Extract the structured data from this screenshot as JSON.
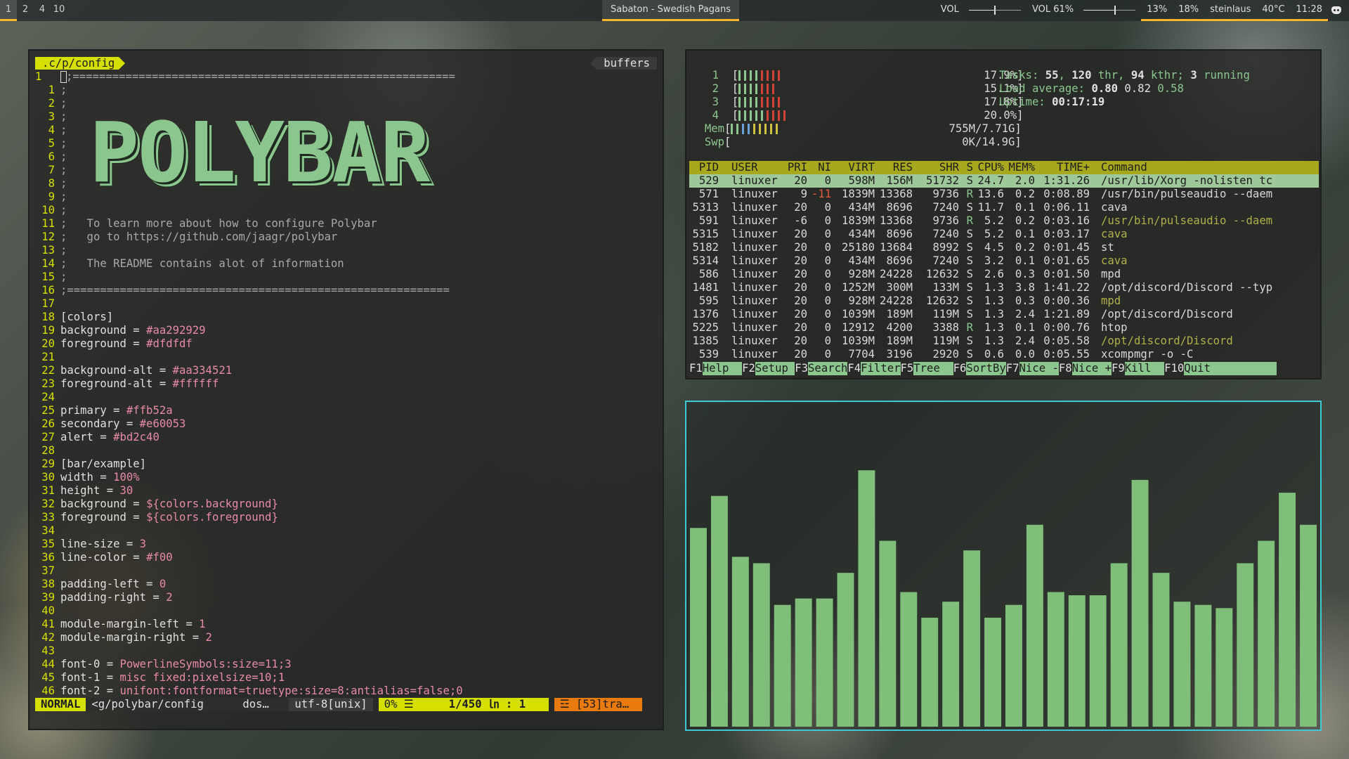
{
  "bar": {
    "workspaces": [
      "1",
      "2",
      "4",
      "10"
    ],
    "active_workspace": "1",
    "window_title": "Sabaton - Swedish Pagans",
    "vol1_label": "VOL",
    "vol1_level": 0.5,
    "vol2_label": "VOL 61%",
    "vol2_level": 0.61,
    "cpu": "13%",
    "mem": "18%",
    "host": "steinlaus",
    "temp": "40°C",
    "clock": "11:28",
    "tray_icon": "discord-icon",
    "accent": "#ffb52a"
  },
  "vim": {
    "path": ".c/p/config",
    "buffers": "buffers",
    "ascii_art": "POLYBAR",
    "lines": [
      {
        "n": "1",
        "t": ";==========================================================",
        "c": true
      },
      {
        "n": "1",
        "t": ";"
      },
      {
        "n": "2",
        "t": ";"
      },
      {
        "n": "3",
        "t": ";"
      },
      {
        "n": "4",
        "t": ";"
      },
      {
        "n": "5",
        "t": ";"
      },
      {
        "n": "6",
        "t": ";"
      },
      {
        "n": "7",
        "t": ";"
      },
      {
        "n": "8",
        "t": ";"
      },
      {
        "n": "9",
        "t": ";"
      },
      {
        "n": "10",
        "t": ";"
      },
      {
        "n": "11",
        "t": ";   To learn more about how to configure Polybar"
      },
      {
        "n": "12",
        "t": ";   go to https://github.com/jaagr/polybar"
      },
      {
        "n": "13",
        "t": ";"
      },
      {
        "n": "14",
        "t": ";   The README contains alot of information"
      },
      {
        "n": "15",
        "t": ";"
      },
      {
        "n": "16",
        "t": ";=========================================================="
      },
      {
        "n": "17",
        "t": ""
      },
      {
        "n": "18",
        "s": "[colors]"
      },
      {
        "n": "19",
        "k": "background = ",
        "v": "#aa292929"
      },
      {
        "n": "20",
        "k": "foreground = ",
        "v": "#dfdfdf"
      },
      {
        "n": "21",
        "t": ""
      },
      {
        "n": "22",
        "k": "background-alt = ",
        "v": "#aa334521"
      },
      {
        "n": "23",
        "k": "foreground-alt = ",
        "v": "#ffffff"
      },
      {
        "n": "24",
        "t": ""
      },
      {
        "n": "25",
        "k": "primary = ",
        "v": "#ffb52a"
      },
      {
        "n": "26",
        "k": "secondary = ",
        "v": "#e60053"
      },
      {
        "n": "27",
        "k": "alert = ",
        "v": "#bd2c40"
      },
      {
        "n": "28",
        "t": ""
      },
      {
        "n": "29",
        "s": "[bar/example]"
      },
      {
        "n": "30",
        "k": "width = ",
        "v": "100%"
      },
      {
        "n": "31",
        "k": "height = ",
        "v": "30"
      },
      {
        "n": "32",
        "k": "background = ",
        "v": "${colors.background}"
      },
      {
        "n": "33",
        "k": "foreground = ",
        "v": "${colors.foreground}"
      },
      {
        "n": "34",
        "t": ""
      },
      {
        "n": "35",
        "k": "line-size = ",
        "v": "3"
      },
      {
        "n": "36",
        "k": "line-color = ",
        "v": "#f00"
      },
      {
        "n": "37",
        "t": ""
      },
      {
        "n": "38",
        "k": "padding-left = ",
        "v": "0"
      },
      {
        "n": "39",
        "k": "padding-right = ",
        "v": "2"
      },
      {
        "n": "40",
        "t": ""
      },
      {
        "n": "41",
        "k": "module-margin-left = ",
        "v": "1"
      },
      {
        "n": "42",
        "k": "module-margin-right = ",
        "v": "2"
      },
      {
        "n": "43",
        "t": ""
      },
      {
        "n": "44",
        "k": "font-0 = ",
        "v": "PowerlineSymbols:size=11;3"
      },
      {
        "n": "45",
        "k": "font-1 = ",
        "v": "misc fixed:pixelsize=10;1"
      },
      {
        "n": "46",
        "k": "font-2 = ",
        "v": "unifont:fontformat=truetype:size=8:antialias=false;0"
      }
    ],
    "status": {
      "mode": "NORMAL",
      "file": "<g/polybar/config",
      "ff": "dos…",
      "enc": "utf-8[unix]",
      "pct": " 0% ☰",
      "pos": "1/450 ㏑ :  1",
      "warn": "☲ [53]tra…"
    }
  },
  "htop": {
    "cpus": [
      {
        "id": "1",
        "value": "17.9%",
        "green": 4,
        "red": 4
      },
      {
        "id": "2",
        "value": "15.1%",
        "green": 4,
        "red": 3
      },
      {
        "id": "3",
        "value": "17.8%",
        "green": 4,
        "red": 4
      },
      {
        "id": "4",
        "value": "20.0%",
        "green": 5,
        "red": 4
      }
    ],
    "mem": {
      "label": "Mem",
      "value": "755M/7.71G"
    },
    "swp": {
      "label": "Swp",
      "value": "0K/14.9G"
    },
    "tasks_label": "Tasks:",
    "tasks": "55",
    "thr": "120",
    "thr_label": "thr,",
    "kthr": "94",
    "kthr_label": "kthr;",
    "running": "3",
    "running_label": "running",
    "load_label": "Load average:",
    "load1": "0.80",
    "load5": "0.82",
    "load15": "0.58",
    "uptime_label": "Uptime:",
    "uptime": "00:17:19",
    "headers": [
      "PID",
      "USER",
      "PRI",
      "NI",
      "VIRT",
      "RES",
      "SHR",
      "S",
      "CPU%",
      "MEM%",
      "TIME+",
      "Command"
    ],
    "processes": [
      [
        "529",
        "linuxer",
        "20",
        "0",
        "598M",
        "156M",
        "51732",
        "S",
        "24.7",
        "2.0",
        "1:31.26",
        "/usr/lib/Xorg -nolisten tc"
      ],
      [
        "571",
        "linuxer",
        "9",
        "-11",
        "1839M",
        "13368",
        "9736",
        "R",
        "13.6",
        "0.2",
        "0:08.89",
        "/usr/bin/pulseaudio --daem"
      ],
      [
        "5313",
        "linuxer",
        "20",
        "0",
        "434M",
        "8696",
        "7240",
        "S",
        "11.7",
        "0.1",
        "0:06.11",
        "cava"
      ],
      [
        "591",
        "linuxer",
        "-6",
        "0",
        "1839M",
        "13368",
        "9736",
        "R",
        "5.2",
        "0.2",
        "0:03.16",
        "/usr/bin/pulseaudio --daem"
      ],
      [
        "5315",
        "linuxer",
        "20",
        "0",
        "434M",
        "8696",
        "7240",
        "S",
        "5.2",
        "0.1",
        "0:03.17",
        "cava"
      ],
      [
        "5182",
        "linuxer",
        "20",
        "0",
        "25180",
        "13684",
        "8992",
        "S",
        "4.5",
        "0.2",
        "0:01.45",
        "st"
      ],
      [
        "5314",
        "linuxer",
        "20",
        "0",
        "434M",
        "8696",
        "7240",
        "S",
        "3.2",
        "0.1",
        "0:01.65",
        "cava"
      ],
      [
        "586",
        "linuxer",
        "20",
        "0",
        "928M",
        "24228",
        "12632",
        "S",
        "2.6",
        "0.3",
        "0:01.50",
        "mpd"
      ],
      [
        "1481",
        "linuxer",
        "20",
        "0",
        "1252M",
        "300M",
        "133M",
        "S",
        "1.3",
        "3.8",
        "1:41.22",
        "/opt/discord/Discord --typ"
      ],
      [
        "595",
        "linuxer",
        "20",
        "0",
        "928M",
        "24228",
        "12632",
        "S",
        "1.3",
        "0.3",
        "0:00.36",
        "mpd"
      ],
      [
        "1376",
        "linuxer",
        "20",
        "0",
        "1039M",
        "189M",
        "119M",
        "S",
        "1.3",
        "2.4",
        "1:21.89",
        "/opt/discord/Discord"
      ],
      [
        "5225",
        "linuxer",
        "20",
        "0",
        "12912",
        "4200",
        "3388",
        "R",
        "1.3",
        "0.1",
        "0:00.76",
        "htop"
      ],
      [
        "1385",
        "linuxer",
        "20",
        "0",
        "1039M",
        "189M",
        "119M",
        "S",
        "1.3",
        "2.4",
        "0:05.58",
        "/opt/discord/Discord"
      ],
      [
        "539",
        "linuxer",
        "20",
        "0",
        "7704",
        "3196",
        "2920",
        "S",
        "0.6",
        "0.0",
        "0:05.55",
        "xcompmgr -o -C"
      ]
    ],
    "thread_rows": [
      3,
      4,
      6,
      9,
      12
    ],
    "fkeys": [
      {
        "k": "F1",
        "l": "Help  "
      },
      {
        "k": "F2",
        "l": "Setup "
      },
      {
        "k": "F3",
        "l": "Search"
      },
      {
        "k": "F4",
        "l": "Filter"
      },
      {
        "k": "F5",
        "l": "Tree  "
      },
      {
        "k": "F6",
        "l": "SortBy"
      },
      {
        "k": "F7",
        "l": "Nice -"
      },
      {
        "k": "F8",
        "l": "Nice +"
      },
      {
        "k": "F9",
        "l": "Kill  "
      },
      {
        "k": "F10",
        "l": "Quit          "
      }
    ]
  },
  "cava": {
    "levels": [
      0.62,
      0.72,
      0.53,
      0.51,
      0.38,
      0.4,
      0.4,
      0.48,
      0.8,
      0.58,
      0.42,
      0.34,
      0.39,
      0.55,
      0.34,
      0.38,
      0.63,
      0.42,
      0.41,
      0.41,
      0.51,
      0.77,
      0.48,
      0.39,
      0.38,
      0.37,
      0.51,
      0.58,
      0.73,
      0.63
    ],
    "bar_color": "#7fbf7a",
    "border_color": "#3fc9d4"
  }
}
